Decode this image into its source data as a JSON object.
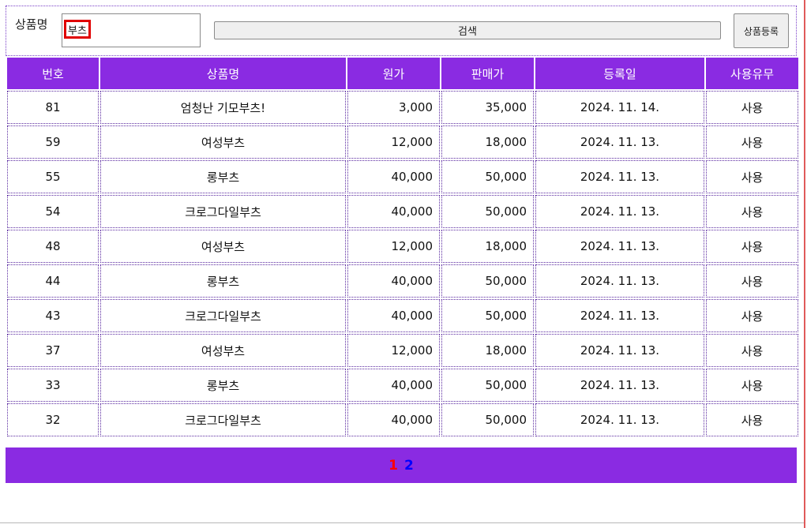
{
  "search": {
    "label": "상품명",
    "value": "부츠",
    "button_label": "검색"
  },
  "toolbar": {
    "register_label": "상품등록"
  },
  "table": {
    "headers": [
      "번호",
      "상품명",
      "원가",
      "판매가",
      "등록일",
      "사용유무"
    ],
    "rows": [
      [
        "81",
        "엄청난 기모부츠!",
        "3,000",
        "35,000",
        "2024. 11. 14.",
        "사용"
      ],
      [
        "59",
        "여성부츠",
        "12,000",
        "18,000",
        "2024. 11. 13.",
        "사용"
      ],
      [
        "55",
        "롱부츠",
        "40,000",
        "50,000",
        "2024. 11. 13.",
        "사용"
      ],
      [
        "54",
        "크로그다일부츠",
        "40,000",
        "50,000",
        "2024. 11. 13.",
        "사용"
      ],
      [
        "48",
        "여성부츠",
        "12,000",
        "18,000",
        "2024. 11. 13.",
        "사용"
      ],
      [
        "44",
        "롱부츠",
        "40,000",
        "50,000",
        "2024. 11. 13.",
        "사용"
      ],
      [
        "43",
        "크로그다일부츠",
        "40,000",
        "50,000",
        "2024. 11. 13.",
        "사용"
      ],
      [
        "37",
        "여성부츠",
        "12,000",
        "18,000",
        "2024. 11. 13.",
        "사용"
      ],
      [
        "33",
        "롱부츠",
        "40,000",
        "50,000",
        "2024. 11. 13.",
        "사용"
      ],
      [
        "32",
        "크로그다일부츠",
        "40,000",
        "50,000",
        "2024. 11. 13.",
        "사용"
      ]
    ]
  },
  "pagination": {
    "pages": [
      {
        "label": "1",
        "color": "#ff0000"
      },
      {
        "label": "2",
        "color": "#0000ff"
      }
    ]
  },
  "colors": {
    "accent": "#8a2be2",
    "current_page": "#ff0000",
    "other_page": "#0000ff",
    "input_highlight": "#e00000"
  }
}
